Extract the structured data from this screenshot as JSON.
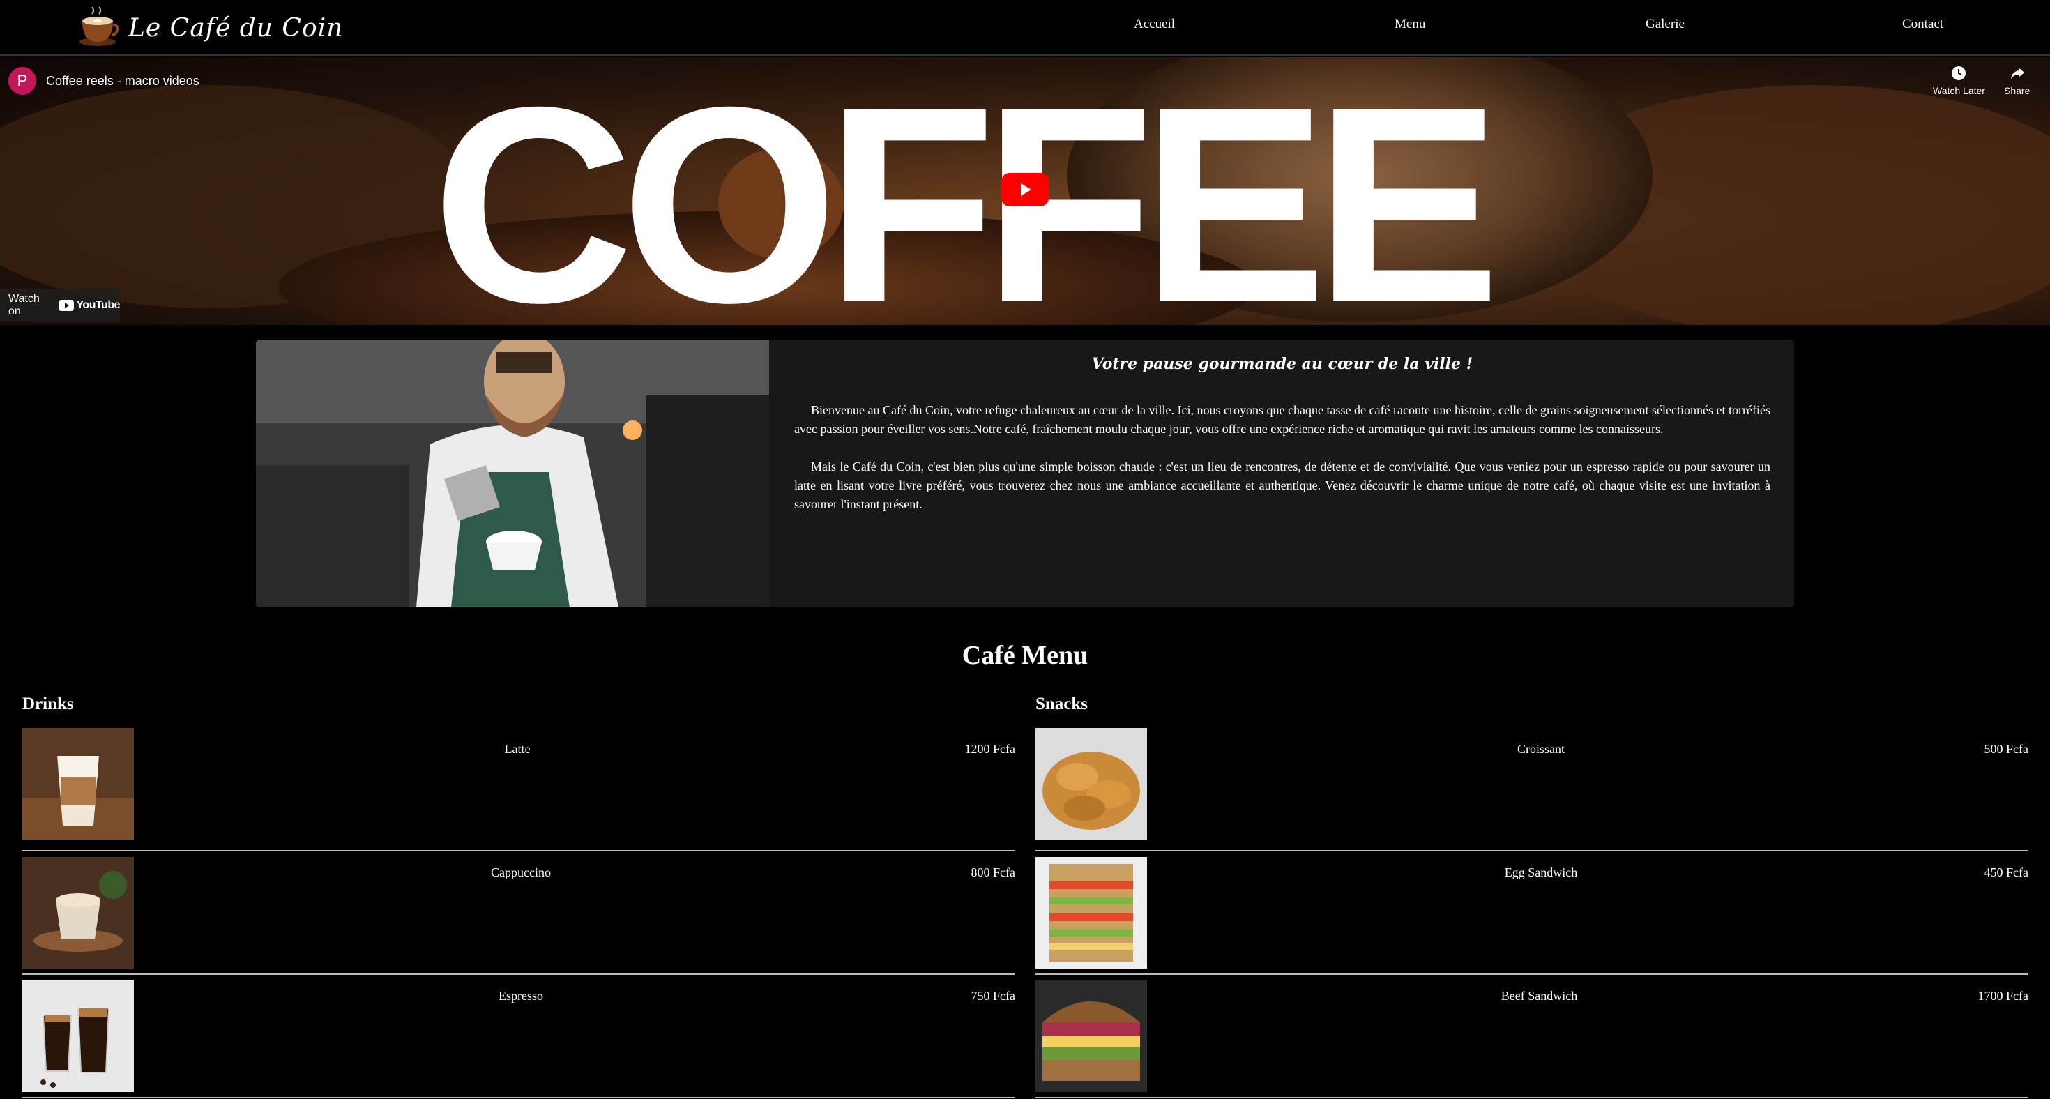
{
  "nav": {
    "logo_text": "Le Café du Coin",
    "links": [
      "Accueil",
      "Menu",
      "Galerie",
      "Contact"
    ]
  },
  "video": {
    "channel_initial": "P",
    "title": "Coffee reels - macro videos",
    "banner_word": "COFFEE",
    "watch_later": "Watch Later",
    "share": "Share",
    "watch_on": "Watch on",
    "youtube": "YouTube"
  },
  "about": {
    "heading": "Votre pause gourmande au cœur de la ville !",
    "paragraphs": [
      "Bienvenue au Café du Coin, votre refuge chaleureux au cœur de la ville. Ici, nous croyons que chaque tasse de café raconte une histoire, celle de grains soigneusement sélectionnés et torréfiés avec passion pour éveiller vos sens.Notre café, fraîchement moulu chaque jour, vous offre une expérience riche et aromatique qui ravit les amateurs comme les connaisseurs.",
      "Mais le Café du Coin, c'est bien plus qu'une simple boisson chaude : c'est un lieu de rencontres, de détente et de convivialité. Que vous veniez pour un espresso rapide ou pour savourer un latte en lisant votre livre préféré, vous trouverez chez nous une ambiance accueillante et authentique. Venez découvrir le charme unique de notre café, où chaque visite est une invitation à savourer l'instant présent."
    ]
  },
  "menu": {
    "title": "Café Menu",
    "drinks": {
      "title": "Drinks",
      "items": [
        {
          "name": "Latte",
          "price": "1200 Fcfa"
        },
        {
          "name": "Cappuccino",
          "price": "800 Fcfa"
        },
        {
          "name": "Espresso",
          "price": "750 Fcfa"
        }
      ]
    },
    "snacks": {
      "title": "Snacks",
      "items": [
        {
          "name": "Croissant",
          "price": "500 Fcfa"
        },
        {
          "name": "Egg Sandwich",
          "price": "450 Fcfa"
        },
        {
          "name": "Beef Sandwich",
          "price": "1700 Fcfa"
        }
      ]
    }
  },
  "colors": {
    "background": "#000000",
    "panel": "#18181a",
    "youtube_red": "#ff0000",
    "avatar": "#c2185b"
  }
}
